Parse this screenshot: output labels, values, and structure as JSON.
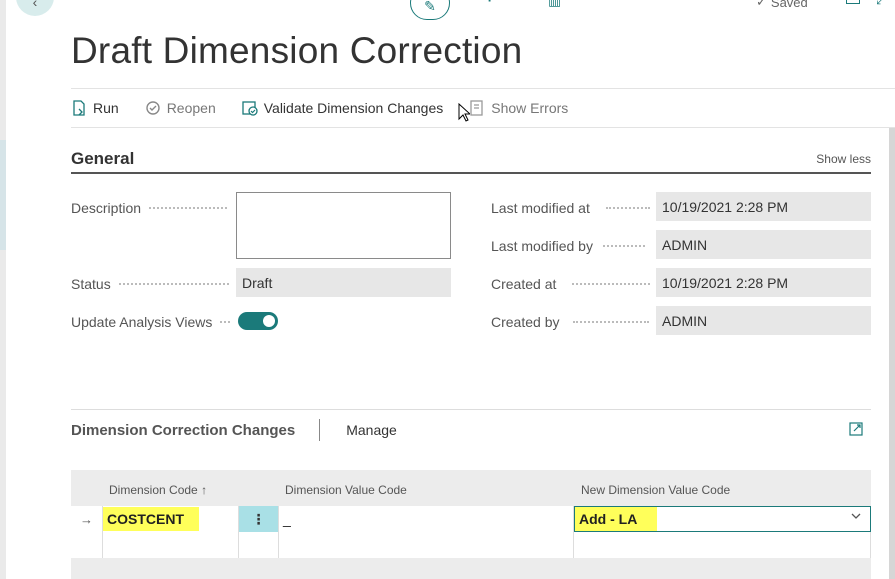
{
  "header": {
    "saved_label": "Saved",
    "title": "Draft Dimension Correction"
  },
  "actions": [
    {
      "label": "Run",
      "icon": "run-icon"
    },
    {
      "label": "Reopen",
      "icon": "reopen-icon"
    },
    {
      "label": "Validate Dimension Changes",
      "icon": "validate-icon"
    },
    {
      "label": "Show Errors",
      "icon": "show-errors-icon"
    }
  ],
  "general": {
    "title": "General",
    "show_less": "Show less",
    "fields": {
      "description": {
        "label": "Description",
        "value": ""
      },
      "status": {
        "label": "Status",
        "value": "Draft"
      },
      "update_analysis_views": {
        "label": "Update Analysis Views",
        "value": true
      },
      "last_modified_at": {
        "label": "Last modified at",
        "value": "10/19/2021 2:28 PM"
      },
      "last_modified_by": {
        "label": "Last modified by",
        "value": "ADMIN"
      },
      "created_at": {
        "label": "Created at",
        "value": "10/19/2021 2:28 PM"
      },
      "created_by": {
        "label": "Created by",
        "value": "ADMIN"
      }
    }
  },
  "changes": {
    "title": "Dimension Correction Changes",
    "manage": "Manage",
    "columns": {
      "dimension_code": "Dimension Code",
      "sort_arrow": "↑",
      "dimension_value_code": "Dimension Value Code",
      "new_dimension_value_code": "New Dimension Value Code"
    },
    "rows": [
      {
        "arrow": "→",
        "dimension_code": "COSTCENT",
        "menu": "⋮",
        "dimension_value_code": "_",
        "new_dimension_value_code": "Add - LA"
      }
    ]
  },
  "colors": {
    "accent": "#1b7a7a",
    "highlight": "#ffff5a",
    "readonly_field": "#e7e7e7"
  }
}
